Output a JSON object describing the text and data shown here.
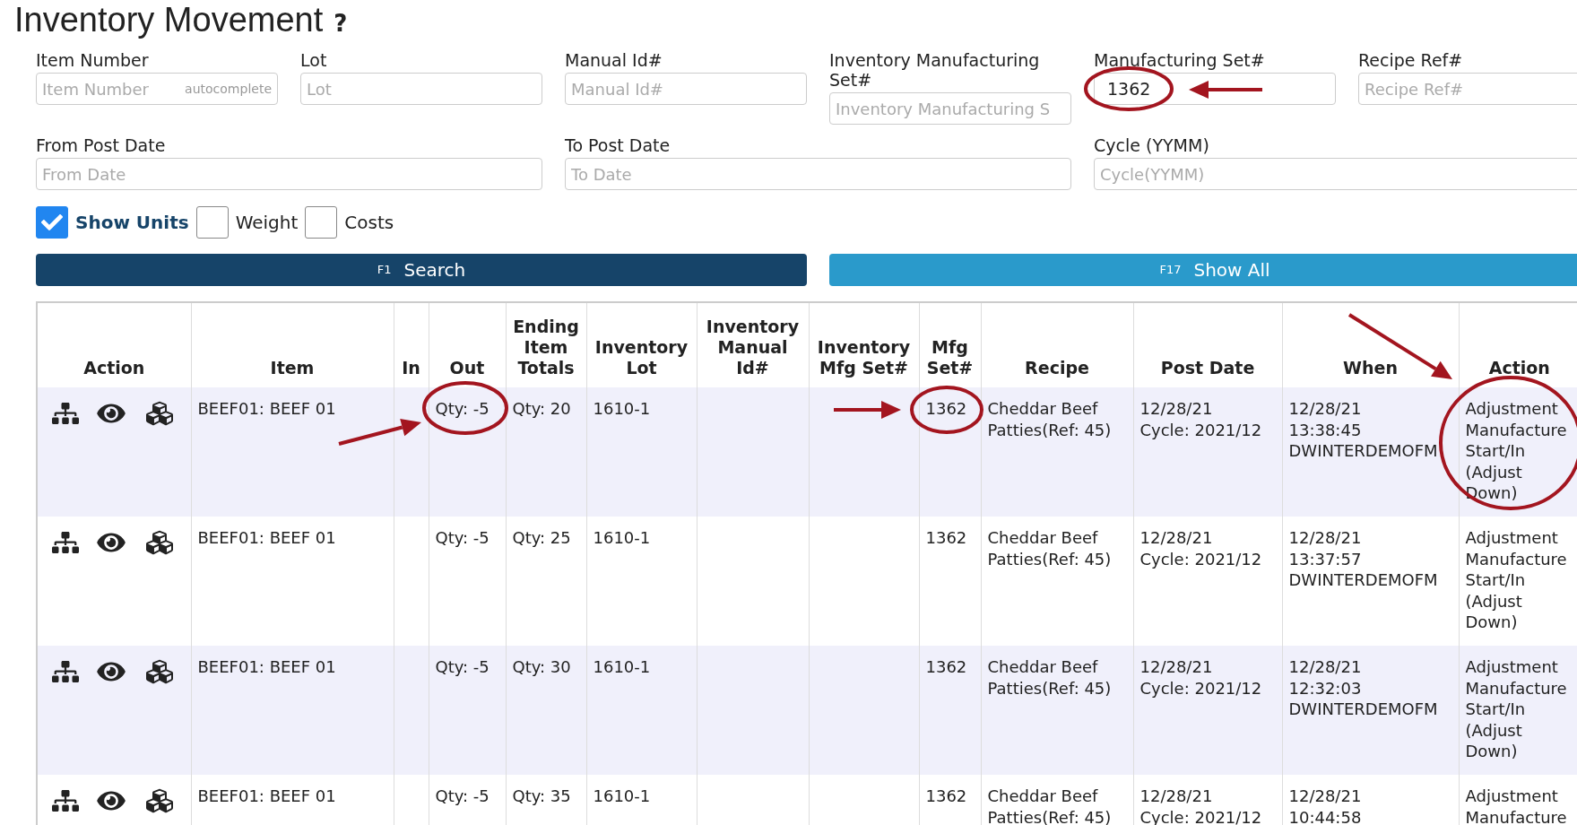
{
  "page": {
    "title": "Inventory Movement",
    "help": "?"
  },
  "filters": [
    {
      "label": "Item Number",
      "placeholder": "Item Number",
      "hint": "autocomplete"
    },
    {
      "label": "Lot",
      "placeholder": "Lot"
    },
    {
      "label": "Manual Id#",
      "placeholder": "Manual Id#"
    },
    {
      "label": "Inventory Manufacturing Set#",
      "placeholder": "Inventory Manufacturing S"
    },
    {
      "label": "Manufacturing Set#",
      "value": "1362"
    },
    {
      "label": "Recipe Ref#",
      "placeholder": "Recipe Ref#"
    },
    {
      "label": "From Post Date",
      "placeholder": "From Date"
    },
    {
      "label": "To Post Date",
      "placeholder": "To Date"
    },
    {
      "label": "Cycle (YYMM)",
      "placeholder": "Cycle(YYMM)"
    }
  ],
  "options": [
    {
      "label": "Show Units",
      "checked": true
    },
    {
      "label": "Weight",
      "checked": false
    },
    {
      "label": "Costs",
      "checked": false
    }
  ],
  "buttons": [
    {
      "key": "F1",
      "label": "Search",
      "kind": "primary"
    },
    {
      "key": "F17",
      "label": "Show All",
      "kind": "secondary"
    }
  ],
  "table": {
    "columns": [
      "Action",
      "Item",
      "In",
      "Out",
      "Ending Item Totals",
      "Inventory Lot",
      "Inventory Manual Id#",
      "Inventory Mfg Set#",
      "Mfg Set#",
      "Recipe",
      "Post Date",
      "When",
      "Action"
    ],
    "rows": [
      {
        "item": "BEEF01: BEEF 01",
        "in": "",
        "out": "Qty: -5",
        "ending": "Qty: 20",
        "lot": "1610-1",
        "manual_id": "",
        "inv_mfg_set": "",
        "mfg_set": "1362",
        "recipe": "Cheddar Beef Patties(Ref: 45)",
        "post_date": "12/28/21",
        "cycle": "Cycle: 2021/12",
        "when_date": "12/28/21",
        "when_time": "13:38:45",
        "user": "DWINTERDEMOFM",
        "action": "Adjustment Manufacture Start/In (Adjust Down)"
      },
      {
        "item": "BEEF01: BEEF 01",
        "in": "",
        "out": "Qty: -5",
        "ending": "Qty: 25",
        "lot": "1610-1",
        "manual_id": "",
        "inv_mfg_set": "",
        "mfg_set": "1362",
        "recipe": "Cheddar Beef Patties(Ref: 45)",
        "post_date": "12/28/21",
        "cycle": "Cycle: 2021/12",
        "when_date": "12/28/21",
        "when_time": "13:37:57",
        "user": "DWINTERDEMOFM",
        "action": "Adjustment Manufacture Start/In (Adjust Down)"
      },
      {
        "item": "BEEF01: BEEF 01",
        "in": "",
        "out": "Qty: -5",
        "ending": "Qty: 30",
        "lot": "1610-1",
        "manual_id": "",
        "inv_mfg_set": "",
        "mfg_set": "1362",
        "recipe": "Cheddar Beef Patties(Ref: 45)",
        "post_date": "12/28/21",
        "cycle": "Cycle: 2021/12",
        "when_date": "12/28/21",
        "when_time": "12:32:03",
        "user": "DWINTERDEMOFM",
        "action": "Adjustment Manufacture Start/In (Adjust Down)"
      },
      {
        "item": "BEEF01: BEEF 01",
        "in": "",
        "out": "Qty: -5",
        "ending": "Qty: 35",
        "lot": "1610-1",
        "manual_id": "",
        "inv_mfg_set": "",
        "mfg_set": "1362",
        "recipe": "Cheddar Beef Patties(Ref: 45)",
        "post_date": "12/28/21",
        "cycle": "Cycle: 2021/12",
        "when_date": "12/28/21",
        "when_time": "10:44:58",
        "action": "Adjustment Manufacture"
      }
    ]
  }
}
